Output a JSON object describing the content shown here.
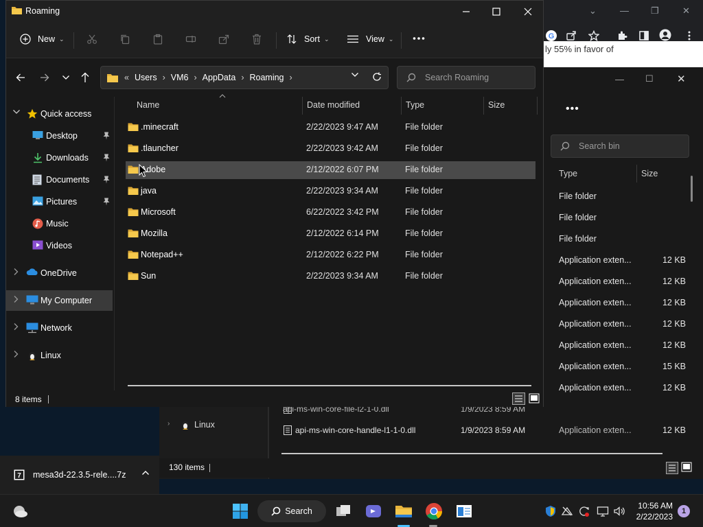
{
  "window": {
    "title": "Roaming"
  },
  "toolbar": {
    "new_label": "New",
    "sort_label": "Sort",
    "view_label": "View"
  },
  "address": {
    "crumbs": [
      "Users",
      "VM6",
      "AppData",
      "Roaming"
    ]
  },
  "search": {
    "placeholder": "Search Roaming"
  },
  "sidebar": {
    "quick_access": "Quick access",
    "items": [
      {
        "label": "Desktop",
        "pinned": true,
        "icon": "desktop-icon"
      },
      {
        "label": "Downloads",
        "pinned": true,
        "icon": "download-icon"
      },
      {
        "label": "Documents",
        "pinned": true,
        "icon": "document-icon"
      },
      {
        "label": "Pictures",
        "pinned": true,
        "icon": "pictures-icon"
      },
      {
        "label": "Music",
        "pinned": false,
        "icon": "music-icon"
      },
      {
        "label": "Videos",
        "pinned": false,
        "icon": "videos-icon"
      }
    ],
    "onedrive": "OneDrive",
    "my_computer": "My Computer",
    "network": "Network",
    "linux": "Linux"
  },
  "columns": {
    "name": "Name",
    "date": "Date modified",
    "type": "Type",
    "size": "Size"
  },
  "files": [
    {
      "name": ".minecraft",
      "date": "2/22/2023 9:47 AM",
      "type": "File folder"
    },
    {
      "name": ".tlauncher",
      "date": "2/22/2023 9:42 AM",
      "type": "File folder"
    },
    {
      "name": "Adobe",
      "date": "2/12/2022 6:07 PM",
      "type": "File folder"
    },
    {
      "name": "java",
      "date": "2/22/2023 9:34 AM",
      "type": "File folder"
    },
    {
      "name": "Microsoft",
      "date": "6/22/2022 3:42 PM",
      "type": "File folder"
    },
    {
      "name": "Mozilla",
      "date": "2/12/2022 6:14 PM",
      "type": "File folder"
    },
    {
      "name": "Notepad++",
      "date": "2/12/2022 6:22 PM",
      "type": "File folder"
    },
    {
      "name": "Sun",
      "date": "2/22/2023 9:34 AM",
      "type": "File folder"
    }
  ],
  "status": {
    "items": "8 items"
  },
  "background_explorer": {
    "search_placeholder": "Search bin",
    "col_type": "Type",
    "col_size": "Size",
    "rows": [
      {
        "type": "File folder",
        "size": ""
      },
      {
        "type": "File folder",
        "size": ""
      },
      {
        "type": "File folder",
        "size": ""
      },
      {
        "type": "Application exten...",
        "size": "12 KB"
      },
      {
        "type": "Application exten...",
        "size": "12 KB"
      },
      {
        "type": "Application exten...",
        "size": "12 KB"
      },
      {
        "type": "Application exten...",
        "size": "12 KB"
      },
      {
        "type": "Application exten...",
        "size": "12 KB"
      },
      {
        "type": "Application exten...",
        "size": "15 KB"
      },
      {
        "type": "Application exten...",
        "size": "12 KB"
      },
      {
        "type": "Application exten...",
        "size": "12 KB"
      },
      {
        "type": "Application exten...",
        "size": "12 KB"
      }
    ],
    "files": [
      {
        "name": "api-ms-win-core-file-l2-1-0.dll",
        "date": "1/9/2023 8:59 AM"
      },
      {
        "name": "api-ms-win-core-handle-l1-1-0.dll",
        "date": "1/9/2023 8:59 AM"
      }
    ],
    "linux": "Linux",
    "status": "130 items"
  },
  "chrome_page_text": "ly 55% in favor of",
  "download": {
    "filename": "mesa3d-22.3.5-rele....7z"
  },
  "taskbar": {
    "search_label": "Search",
    "time": "10:56 AM",
    "date": "2/22/2023",
    "notification_count": "1"
  },
  "colors": {
    "folder": "#e8b53c",
    "selection": "#4a4a4a",
    "accent": "#4cc2ff"
  }
}
